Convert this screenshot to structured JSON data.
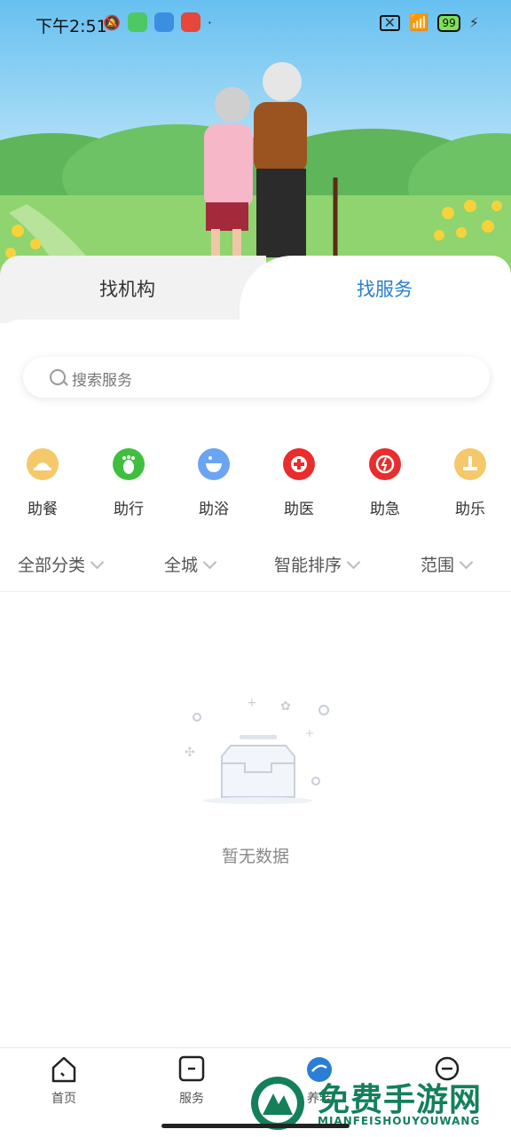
{
  "status": {
    "time": "下午2:51",
    "battery": "99"
  },
  "tabs": {
    "left_label": "找机构",
    "right_label": "找服务"
  },
  "search": {
    "placeholder": "搜索服务"
  },
  "services": [
    {
      "label": "助餐",
      "icon": "meal-icon",
      "color": "#f5c86a"
    },
    {
      "label": "助行",
      "icon": "walk-icon",
      "color": "#3fbf3f"
    },
    {
      "label": "助浴",
      "icon": "bath-icon",
      "color": "#6aa4f3"
    },
    {
      "label": "助医",
      "icon": "medical-icon",
      "color": "#ea2c2c"
    },
    {
      "label": "助急",
      "icon": "emergency-icon",
      "color": "#e82d2d"
    },
    {
      "label": "助乐",
      "icon": "fun-icon",
      "color": "#f5c86a"
    }
  ],
  "filters": {
    "category": "全部分类",
    "city": "全城",
    "sort": "智能排序",
    "range": "范围"
  },
  "empty": {
    "text": "暂无数据"
  },
  "nav": {
    "home": "首页",
    "service": "服务",
    "elder": "养老",
    "mine_icon": "smile-icon"
  },
  "watermark": {
    "title": "免费手游网",
    "subtitle": "MIANFEISHOUYOUWANG"
  },
  "colors": {
    "accent": "#2a7fd4",
    "sky": "#67c0f0"
  }
}
